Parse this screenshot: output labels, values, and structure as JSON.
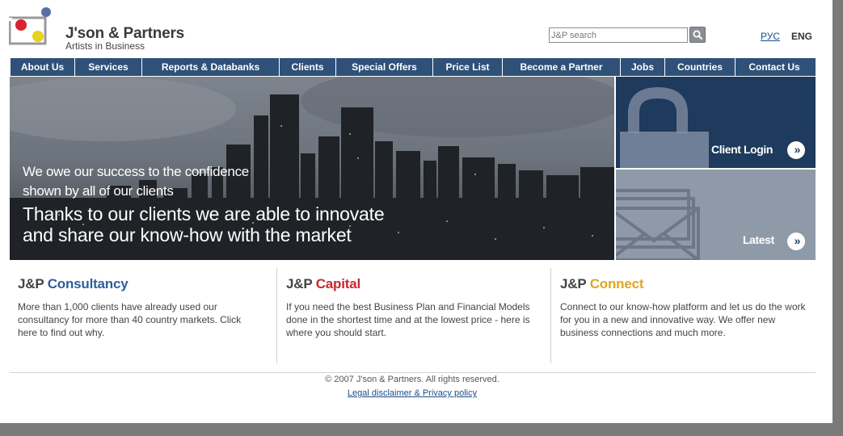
{
  "brand": {
    "name": "J'son & Partners",
    "tagline": "Artists in Business",
    "colors": {
      "red": "#d9232e",
      "yellow": "#e8d21b",
      "blue": "#2f5178",
      "navy": "#1e3a5c"
    }
  },
  "search": {
    "placeholder": "J&P search",
    "button_icon": "search-icon"
  },
  "languages": {
    "ru": "РУС",
    "en": "ENG"
  },
  "nav": [
    "About Us",
    "Services",
    "Reports & Databanks",
    "Clients",
    "Special Offers",
    "Price List",
    "Become a Partner",
    "Jobs",
    "Countries",
    "Contact Us"
  ],
  "hero": {
    "line1": "We owe our success to the confidence",
    "line2": "shown by all of our clients",
    "line3": "Thanks to our clients we are able to innovate",
    "line4": "and share our know-how with the market"
  },
  "panels": {
    "login": {
      "label": "Client Login",
      "icon": "lock-icon"
    },
    "latest": {
      "label": "Latest",
      "icon": "envelope-icon"
    }
  },
  "columns": [
    {
      "prefix": "J&P ",
      "name": "Consultancy",
      "color": "#2f5d9e",
      "text": "More than 1,000 clients have already used our consultancy for more than 40 country markets. Click here to find out why."
    },
    {
      "prefix": "J&P ",
      "name": "Capital",
      "color": "#c7282f",
      "text": "If you need the best Business Plan and Financial Models done in the shortest time and at the lowest price - here is where you should start."
    },
    {
      "prefix": "J&P ",
      "name": "Connect",
      "color": "#e0a424",
      "text": "Connect to our know-how platform and let us do the work for you in a new and innovative way. We offer new business connections and much more."
    }
  ],
  "footer": {
    "copyright": "© 2007 J'son & Partners. All rights reserved.",
    "legal": "Legal disclaimer & Privacy policy"
  }
}
